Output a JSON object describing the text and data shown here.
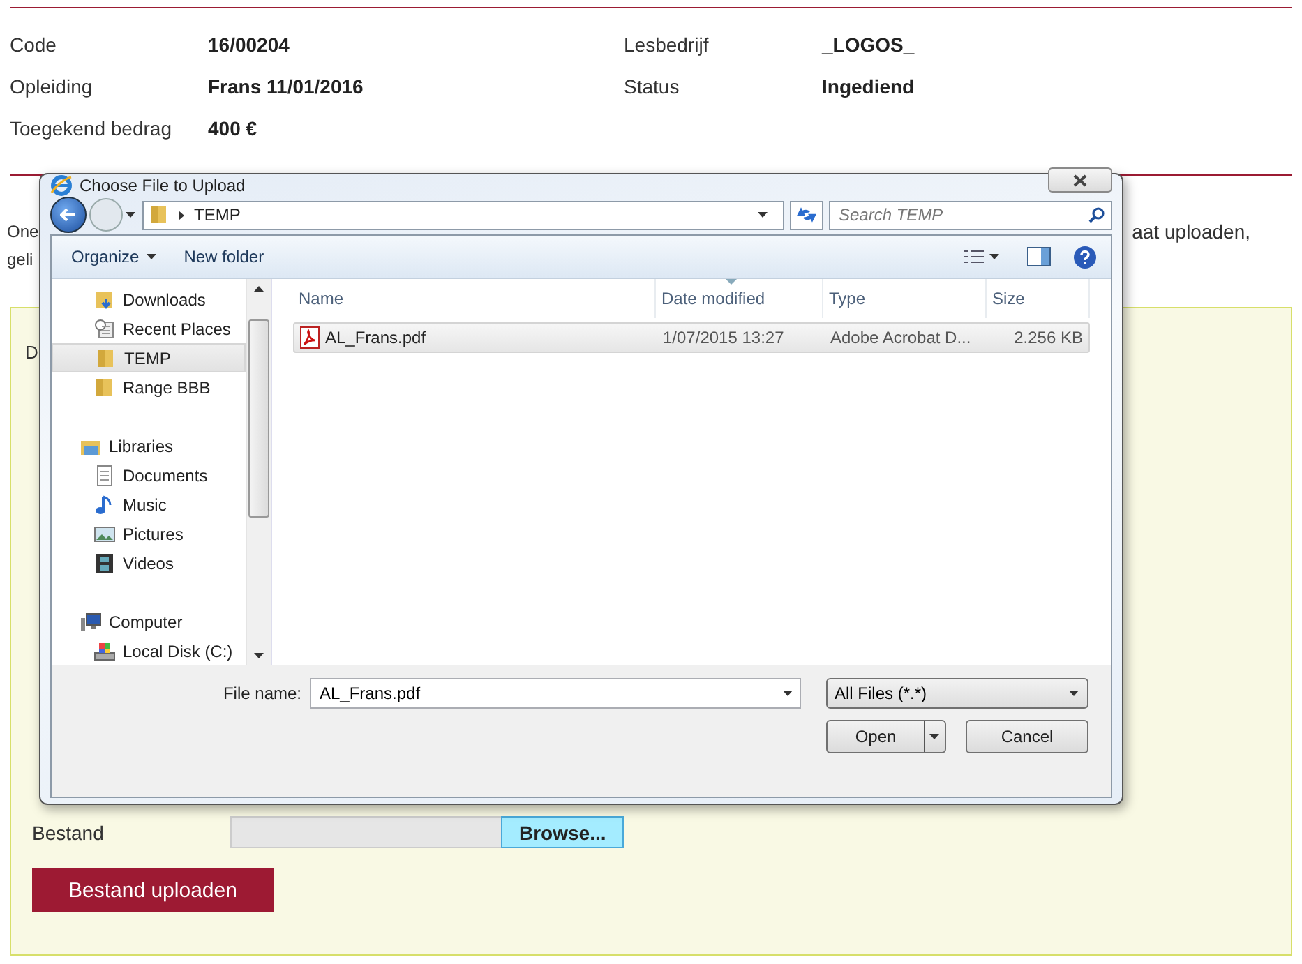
{
  "details": [
    {
      "label": "Code",
      "value": "16/00204"
    },
    {
      "label": "Lesbedrijf",
      "value": "_LOGOS_"
    },
    {
      "label": "Opleiding",
      "value": "Frans 11/01/2016"
    },
    {
      "label": "Status",
      "value": "Ingediend"
    },
    {
      "label": "Toegekend bedrag",
      "value": "400 €"
    }
  ],
  "intro_fragments": {
    "left": [
      "One",
      "geli"
    ],
    "right": "aat uploaden,"
  },
  "panel": {
    "label_fragment": "D",
    "file_label": "Bestand",
    "browse_button": "Browse...",
    "upload_button": "Bestand uploaden"
  },
  "dialog": {
    "title": "Choose File to Upload",
    "path": "TEMP",
    "search": {
      "placeholder": "Search TEMP"
    },
    "toolbar": [
      "Organize",
      "New folder"
    ],
    "nav": [
      {
        "children": [
          {
            "label": "Downloads",
            "kind": "downloads",
            "selected": false
          },
          {
            "label": "Recent Places",
            "kind": "recent",
            "selected": false
          },
          {
            "label": "TEMP",
            "kind": "folder",
            "selected": true
          },
          {
            "label": "Range BBB",
            "kind": "folder",
            "selected": false
          }
        ]
      },
      {
        "label": "Libraries",
        "kind": "library",
        "selected": false,
        "children": [
          {
            "label": "Documents",
            "kind": "documents",
            "selected": false
          },
          {
            "label": "Music",
            "kind": "music",
            "selected": false
          },
          {
            "label": "Pictures",
            "kind": "pictures",
            "selected": false
          },
          {
            "label": "Videos",
            "kind": "videos",
            "selected": false
          }
        ]
      },
      {
        "label": "Computer",
        "kind": "computer",
        "selected": false,
        "children": [
          {
            "label": "Local Disk (C:)",
            "kind": "disk",
            "selected": false
          }
        ]
      }
    ],
    "columns": [
      {
        "label": "Name",
        "sorted": false
      },
      {
        "label": "Date modified",
        "sorted": true
      },
      {
        "label": "Type",
        "sorted": false
      },
      {
        "label": "Size",
        "sorted": false
      }
    ],
    "files": [
      {
        "name": "AL_Frans.pdf",
        "date": "1/07/2015 13:27",
        "type": "Adobe Acrobat D...",
        "size": "2.256 KB",
        "selected": true
      }
    ],
    "file_name_label": "File name:",
    "file_name": "AL_Frans.pdf",
    "filter": "All Files (*.*)",
    "buttons": [
      "Open",
      "Cancel"
    ]
  }
}
